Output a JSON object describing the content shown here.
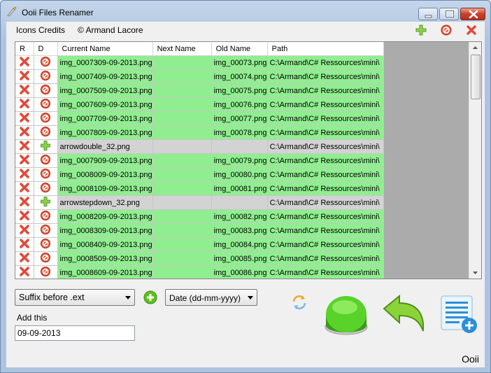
{
  "window": {
    "title": "Ooii Files Renamer"
  },
  "menu": {
    "items": [
      "Icons Credits",
      "© Armand Lacore"
    ]
  },
  "grid": {
    "columns": [
      "R",
      "D",
      "Current Name",
      "Next Name",
      "Old Name",
      "Path"
    ],
    "rows": [
      {
        "status": "green",
        "d_icon": "no-entry-icon",
        "current": "img_0007309-09-2013.png",
        "next": "",
        "old": "img_00073.png",
        "path": "C:\\Armand\\C# Ressources\\mini\\"
      },
      {
        "status": "green",
        "d_icon": "no-entry-icon",
        "current": "img_0007409-09-2013.png",
        "next": "",
        "old": "img_00074.png",
        "path": "C:\\Armand\\C# Ressources\\mini\\"
      },
      {
        "status": "green",
        "d_icon": "no-entry-icon",
        "current": "img_0007509-09-2013.png",
        "next": "",
        "old": "img_00075.png",
        "path": "C:\\Armand\\C# Ressources\\mini\\"
      },
      {
        "status": "green",
        "d_icon": "no-entry-icon",
        "current": "img_0007609-09-2013.png",
        "next": "",
        "old": "img_00076.png",
        "path": "C:\\Armand\\C# Ressources\\mini\\"
      },
      {
        "status": "green",
        "d_icon": "no-entry-icon",
        "current": "img_0007709-09-2013.png",
        "next": "",
        "old": "img_00077.png",
        "path": "C:\\Armand\\C# Ressources\\mini\\"
      },
      {
        "status": "green",
        "d_icon": "no-entry-icon",
        "current": "img_0007809-09-2013.png",
        "next": "",
        "old": "img_00078.png",
        "path": "C:\\Armand\\C# Ressources\\mini\\"
      },
      {
        "status": "gray",
        "d_icon": "plus-icon",
        "current": "arrowdouble_32.png",
        "next": "",
        "old": "",
        "path": "C:\\Armand\\C# Ressources\\mini\\"
      },
      {
        "status": "green",
        "d_icon": "no-entry-icon",
        "current": "img_0007909-09-2013.png",
        "next": "",
        "old": "img_00079.png",
        "path": "C:\\Armand\\C# Ressources\\mini\\"
      },
      {
        "status": "green",
        "d_icon": "no-entry-icon",
        "current": "img_0008009-09-2013.png",
        "next": "",
        "old": "img_00080.png",
        "path": "C:\\Armand\\C# Ressources\\mini\\"
      },
      {
        "status": "green",
        "d_icon": "no-entry-icon",
        "current": "img_0008109-09-2013.png",
        "next": "",
        "old": "img_00081.png",
        "path": "C:\\Armand\\C# Ressources\\mini\\"
      },
      {
        "status": "gray",
        "d_icon": "plus-icon",
        "current": "arrowstepdown_32.png",
        "next": "",
        "old": "",
        "path": "C:\\Armand\\C# Ressources\\mini\\"
      },
      {
        "status": "green",
        "d_icon": "no-entry-icon",
        "current": "img_0008209-09-2013.png",
        "next": "",
        "old": "img_00082.png",
        "path": "C:\\Armand\\C# Ressources\\mini\\"
      },
      {
        "status": "green",
        "d_icon": "no-entry-icon",
        "current": "img_0008309-09-2013.png",
        "next": "",
        "old": "img_00083.png",
        "path": "C:\\Armand\\C# Ressources\\mini\\"
      },
      {
        "status": "green",
        "d_icon": "no-entry-icon",
        "current": "img_0008409-09-2013.png",
        "next": "",
        "old": "img_00084.png",
        "path": "C:\\Armand\\C# Ressources\\mini\\"
      },
      {
        "status": "green",
        "d_icon": "no-entry-icon",
        "current": "img_0008509-09-2013.png",
        "next": "",
        "old": "img_00085.png",
        "path": "C:\\Armand\\C# Ressources\\mini\\"
      },
      {
        "status": "green",
        "d_icon": "no-entry-icon",
        "current": "img_0008609-09-2013.png",
        "next": "",
        "old": "img_00086.png",
        "path": "C:\\Armand\\C# Ressources\\mini\\"
      }
    ]
  },
  "controls": {
    "mode_select": "Suffix before .ext",
    "format_select": "Date (dd-mm-yyyy)",
    "add_label": "Add this",
    "add_value": "09-09-2013"
  },
  "brand": "Ooii",
  "colors": {
    "row_green": "#90ee90",
    "row_gray": "#d3d3d3",
    "accent_red": "#d9422b",
    "accent_green": "#5cc31d"
  }
}
